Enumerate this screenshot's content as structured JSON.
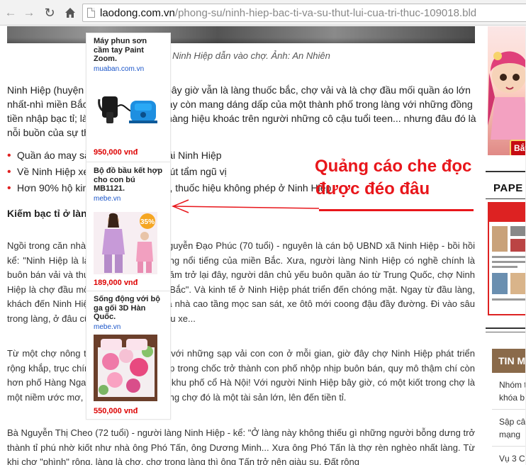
{
  "browser": {
    "back_icon": "back-arrow-icon",
    "forward_icon": "forward-arrow-icon",
    "reload_icon": "reload-icon",
    "home_icon": "home-icon",
    "url_host": "laodong.com.vn",
    "url_path": "/phong-su/ninh-hiep-bac-ti-va-su-thut-lui-cua-tri-thuc-109018.bld"
  },
  "article": {
    "caption": "...ng Ninh Hiệp dẫn vào chợ. Ảnh: An Nhiên",
    "lead": "Ninh Hiệp (huyện Gia Lâm, Hà Nội) bây giờ vẫn là làng thuốc bắc, chợ vải và là chợ đầu mối quần áo lớn nhất-nhì miền Bắc. Ninh Hiệp hôm nay còn mang dáng dấp của một thành phố trong làng với những đồng tiền nhập bạc tỉ; là biệt thự, siêu xe, hàng hiệu khoác trên người những cô cậu tuổi teen... nhưng đâu đó là nỗi buồn của sự thụt lùi tri thức...",
    "related": [
      "Quần áo may sẵn tràn ngập chợ vải Ninh Hiệp",
      "Về Ninh Hiệp xem làm thuốc đan cút tẩm ngũ vị",
      "Hơn 90% hộ kinh doanh thuốc bắc, thuốc hiệu không phép ở Ninh Hiệp"
    ],
    "subhead": "Kiếm bạc tỉ ở làng",
    "para1": "Ngồi trong căn nhà khang trang, ông Nguyễn Đạo Phúc (70 tuổi) - nguyên là cán bộ UBND xã Ninh Hiệp - bồi hồi kể: \"Ninh Hiệp là làng nghề truyền thống nổi tiếng của miền Bắc. Xưa, người làng Ninh Hiệp có nghề chính là buôn bán vải và thuốc bắc. Khoảng 5 năm trở lại đây, người dân chủ yếu buôn quần áo từ Trung Quốc, chợ Ninh Hiệp là chợ đầu mối lớn nhất-nhì miền Bắc\". Và kinh tế ở Ninh Hiệp phát triển đến chóng mặt. Ngay từ đầu làng, khách đến Ninh Hiệp đã thấy những tòa nhà cao tầng mọc san sát, xe ôtô mới coong đậu đầy đường. Đi vào sâu trong làng, ở đâu cũng thấy biệt thự, siêu xe...",
    "para2": "Từ một chợ nông thôn nhỏ bé bán vải với những sạp vải con con ở mỗi gian, giờ đây chợ Ninh Hiệp phát triển rộng khắp, trục chính của chợ Ninh Hiệp trong chốc trở thành con phố nhộp nhịp buôn bán, quy mô thậm chí còn hơn phố Hàng Ngang, Hàng Đào... của khu phố cổ Hà Nội! Với người Ninh Hiệp bây giờ, có một kiốt trong chợ là một niềm ước mơ, bởi vì có một kiốt trong chợ đó là một tài sản lớn, lên đến tiền tỉ.",
    "para3": "Bà Nguyễn Thị Cheo (72 tuổi) - người làng Ninh Hiệp - kể: \"Ở làng này không thiếu gì những người bỗng dưng trở thành tỉ phú nhờ kiốt như nhà ông Phó Tấn, ông Dương Minh... Xưa ông Phó Tấn là thợ rèn nghèo nhất làng. Từ khi chợ \"phình\" rộng, làng là chợ, chợ trong làng thì ông Tấn trở nên giàu sụ. Đất rộng"
  },
  "annotation": {
    "line1": "Quảng cáo che đọc",
    "line2": "được đéo đâu"
  },
  "ads": [
    {
      "title": "Máy phun sơn cầm tay Paint Zoom.",
      "domain": "muaban.com.vn",
      "price": "950,000 vnđ",
      "image": "paint-sprayer-image"
    },
    {
      "title": "Bộ đồ bầu kết hợp cho con bú MB1121.",
      "domain": "mebe.vn",
      "price": "189,000 vnđ",
      "badge": "35%",
      "image": "maternity-clothes-image"
    },
    {
      "title": "Sống động với bộ ga gối 3D Hàn Quốc.",
      "domain": "mebe.vn",
      "price": "550,000 vnđ",
      "image": "bedding-3d-image"
    }
  ],
  "sidebar": {
    "game_button": "Bắt",
    "paper_label": "PAPE",
    "tin_box": "TIN M",
    "items": [
      "Nhóm t",
      "khóa b",
      "Sập câu",
      "mạng",
      "Vụ 3 C"
    ]
  },
  "colors": {
    "annotation_red": "#e8161b",
    "price_red": "#dd0000",
    "ad_domain_blue": "#1a55c9",
    "bullet_red": "#e02020"
  }
}
